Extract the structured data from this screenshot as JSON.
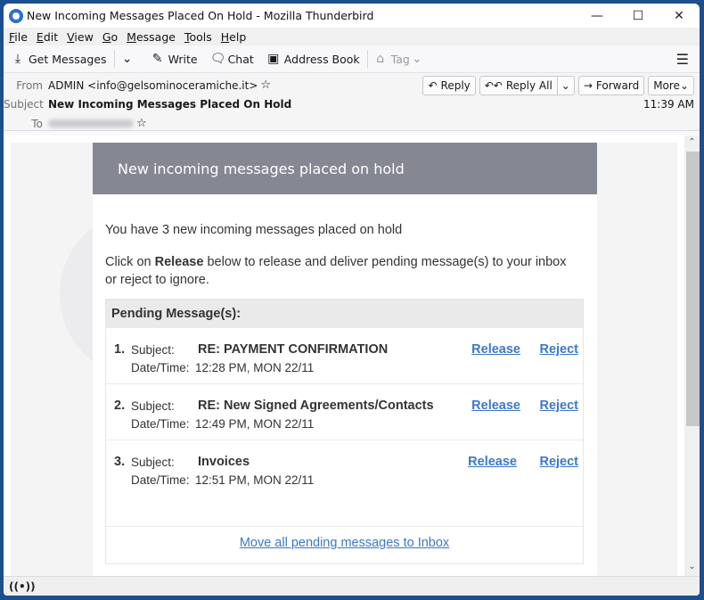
{
  "window": {
    "title": "New Incoming Messages Placed On Hold - Mozilla Thunderbird",
    "controls": {
      "minimize": "—",
      "maximize": "☐",
      "close": "✕"
    }
  },
  "menu": {
    "items": [
      {
        "label": "File",
        "accel": "F",
        "rest": "ile"
      },
      {
        "label": "Edit",
        "accel": "E",
        "rest": "dit"
      },
      {
        "label": "View",
        "accel": "V",
        "rest": "iew"
      },
      {
        "label": "Go",
        "accel": "G",
        "rest": "o"
      },
      {
        "label": "Message",
        "accel": "M",
        "rest": "essage"
      },
      {
        "label": "Tools",
        "accel": "T",
        "rest": "ools"
      },
      {
        "label": "Help",
        "accel": "H",
        "rest": "elp"
      }
    ]
  },
  "toolbar": {
    "get_messages": "Get Messages",
    "write": "Write",
    "chat": "Chat",
    "address_book": "Address Book",
    "tag": "Tag",
    "icons": {
      "get_messages": "⤓",
      "dropdown": "⌄",
      "write": "✎",
      "chat": "🗨",
      "address_book": "▣",
      "tag": "⌂",
      "menu": "☰"
    }
  },
  "header": {
    "from_label": "From",
    "from_value": "ADMIN <info@gelsominoceramiche.it>",
    "subject_label": "Subject",
    "subject_value": "New Incoming Messages Placed On Hold",
    "to_label": "To",
    "time": "11:39 AM",
    "star": "☆",
    "actions": {
      "reply": "Reply",
      "reply_all": "Reply All",
      "forward": "Forward",
      "more": "More",
      "reply_icon": "↶",
      "reply_all_icon": "↶↶",
      "forward_icon": "→",
      "chevron": "⌄"
    }
  },
  "email": {
    "banner": "New incoming messages placed on hold",
    "intro": "You have 3 new incoming messages placed on hold",
    "instructions_pre": "Click on ",
    "instructions_bold": "Release",
    "instructions_post": " below to release and deliver pending message(s) to your inbox or reject to ignore.",
    "pending_header": "Pending Message(s):",
    "subject_label": "Subject:",
    "datetime_label": "Date/Time:",
    "release_label": "Release",
    "reject_label": "Reject",
    "messages": [
      {
        "num": "1.",
        "subject": "RE: PAYMENT CONFIRMATION",
        "datetime": "12:28 PM, MON 22/11"
      },
      {
        "num": "2.",
        "subject": "RE: New Signed Agreements/Contacts",
        "datetime": "12:49 PM, MON 22/11"
      },
      {
        "num": "3.",
        "subject": "Invoices",
        "datetime": "12:51 PM, MON 22/11"
      }
    ],
    "move_all": "Move all pending messages to Inbox"
  },
  "scrollbar": {
    "up": "⌃",
    "down": "⌄"
  },
  "status": {
    "icon": "((•))"
  },
  "colors": {
    "banner": "#858893",
    "link": "#3c78c8",
    "window_frame": "#1f4e8c"
  }
}
